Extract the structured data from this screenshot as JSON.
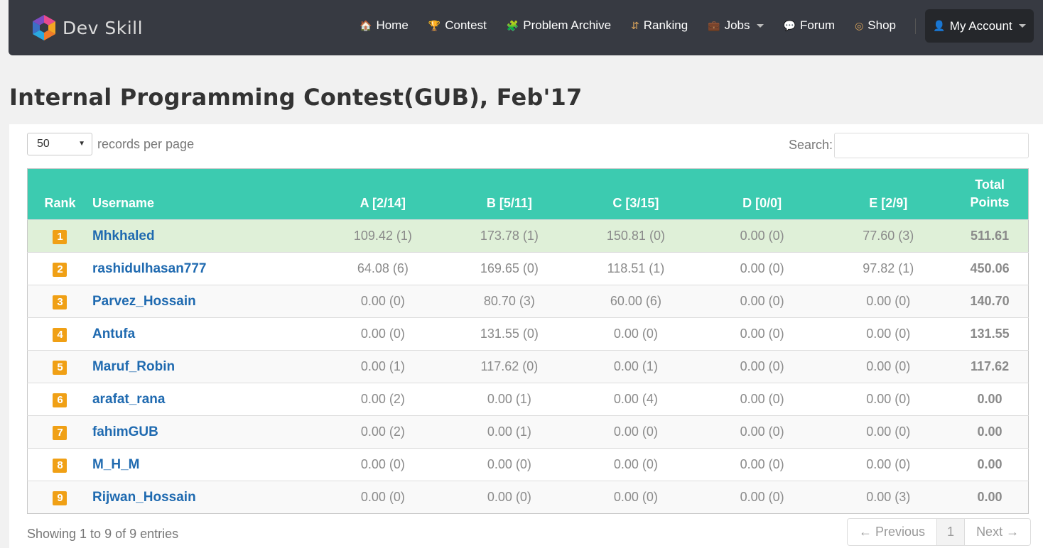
{
  "brand": {
    "name": "Dev Skill",
    "logo_icon": "hexagon-cube-logo-icon"
  },
  "nav": {
    "items": [
      {
        "label": "Home",
        "icon": "home-icon",
        "glyph": "🏠",
        "dropdown": false
      },
      {
        "label": "Contest",
        "icon": "trophy-icon",
        "glyph": "🏆",
        "dropdown": false
      },
      {
        "label": "Problem Archive",
        "icon": "puzzle-icon",
        "glyph": "🧩",
        "dropdown": false
      },
      {
        "label": "Ranking",
        "icon": "sort-icon",
        "glyph": "⇵",
        "dropdown": false
      },
      {
        "label": "Jobs",
        "icon": "briefcase-icon",
        "glyph": "💼",
        "dropdown": true
      },
      {
        "label": "Forum",
        "icon": "comments-icon",
        "glyph": "💬",
        "dropdown": false
      },
      {
        "label": "Shop",
        "icon": "bullseye-icon",
        "glyph": "◎",
        "dropdown": false
      }
    ],
    "account": {
      "label": "My Account",
      "icon": "user-icon",
      "glyph": "👤"
    }
  },
  "page": {
    "title": "Internal Programming Contest(GUB), Feb'17"
  },
  "controls": {
    "page_length": "50",
    "page_length_label": "records per page",
    "search_label": "Search:",
    "search_value": ""
  },
  "table": {
    "headers": {
      "rank": "Rank",
      "username": "Username",
      "problems": [
        "A [2/14]",
        "B [5/11]",
        "C [3/15]",
        "D [0/0]",
        "E [2/9]"
      ],
      "total_line1": "Total",
      "total_line2": "Points"
    },
    "rows": [
      {
        "rank": "1",
        "username": "Mhkhaled",
        "scores": [
          "109.42 (1)",
          "173.78 (1)",
          "150.81 (0)",
          "0.00 (0)",
          "77.60 (3)"
        ],
        "total": "511.61"
      },
      {
        "rank": "2",
        "username": "rashidulhasan777",
        "scores": [
          "64.08 (6)",
          "169.65 (0)",
          "118.51 (1)",
          "0.00 (0)",
          "97.82 (1)"
        ],
        "total": "450.06"
      },
      {
        "rank": "3",
        "username": "Parvez_Hossain",
        "scores": [
          "0.00 (0)",
          "80.70 (3)",
          "60.00 (6)",
          "0.00 (0)",
          "0.00 (0)"
        ],
        "total": "140.70"
      },
      {
        "rank": "4",
        "username": "Antufa",
        "scores": [
          "0.00 (0)",
          "131.55 (0)",
          "0.00 (0)",
          "0.00 (0)",
          "0.00 (0)"
        ],
        "total": "131.55"
      },
      {
        "rank": "5",
        "username": "Maruf_Robin",
        "scores": [
          "0.00 (1)",
          "117.62 (0)",
          "0.00 (1)",
          "0.00 (0)",
          "0.00 (0)"
        ],
        "total": "117.62"
      },
      {
        "rank": "6",
        "username": "arafat_rana",
        "scores": [
          "0.00 (2)",
          "0.00 (1)",
          "0.00 (4)",
          "0.00 (0)",
          "0.00 (0)"
        ],
        "total": "0.00"
      },
      {
        "rank": "7",
        "username": "fahimGUB",
        "scores": [
          "0.00 (2)",
          "0.00 (1)",
          "0.00 (0)",
          "0.00 (0)",
          "0.00 (0)"
        ],
        "total": "0.00"
      },
      {
        "rank": "8",
        "username": "M_H_M",
        "scores": [
          "0.00 (0)",
          "0.00 (0)",
          "0.00 (0)",
          "0.00 (0)",
          "0.00 (0)"
        ],
        "total": "0.00"
      },
      {
        "rank": "9",
        "username": "Rijwan_Hossain",
        "scores": [
          "0.00 (0)",
          "0.00 (0)",
          "0.00 (0)",
          "0.00 (0)",
          "0.00 (3)"
        ],
        "total": "0.00"
      }
    ]
  },
  "footer": {
    "info": "Showing 1 to 9 of 9 entries",
    "prev": "← Previous",
    "page": "1",
    "next": "Next →"
  },
  "colors": {
    "navbar": "#373a42",
    "header_row": "#3ccbb0",
    "winner_row": "#dff0d8",
    "rank_badge": "#f0a015",
    "username_link": "#1f6ab0",
    "nav_icon": "#d9a35b"
  }
}
